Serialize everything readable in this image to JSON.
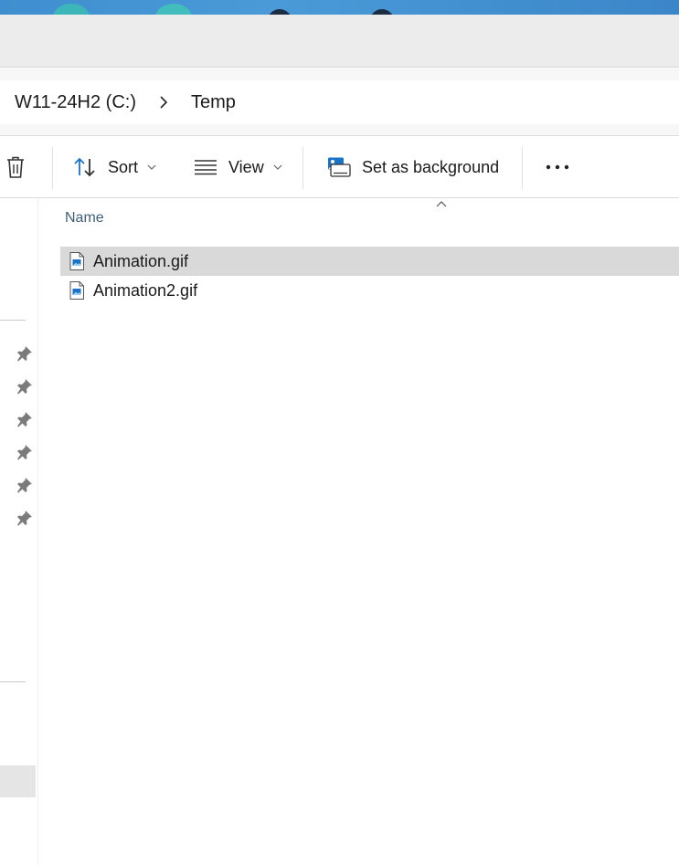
{
  "breadcrumb": {
    "items": [
      {
        "label": "W11-24H2 (C:)"
      },
      {
        "label": "Temp"
      }
    ]
  },
  "toolbar": {
    "sort_label": "Sort",
    "view_label": "View",
    "set_background_label": "Set as background"
  },
  "columns": {
    "name_header": "Name"
  },
  "files": [
    {
      "name": "Animation.gif",
      "selected": true
    },
    {
      "name": "Animation2.gif",
      "selected": false
    }
  ],
  "colors": {
    "accent": "#1a73c9",
    "selection": "#d9d9d9",
    "header_text": "#3e5f7a"
  },
  "icons": {
    "delete": "trash-icon",
    "sort": "sort-arrows-icon",
    "view": "view-lines-icon",
    "background": "set-background-icon",
    "more": "more-dots-icon",
    "pin": "pin-icon",
    "file": "gif-file-icon"
  }
}
